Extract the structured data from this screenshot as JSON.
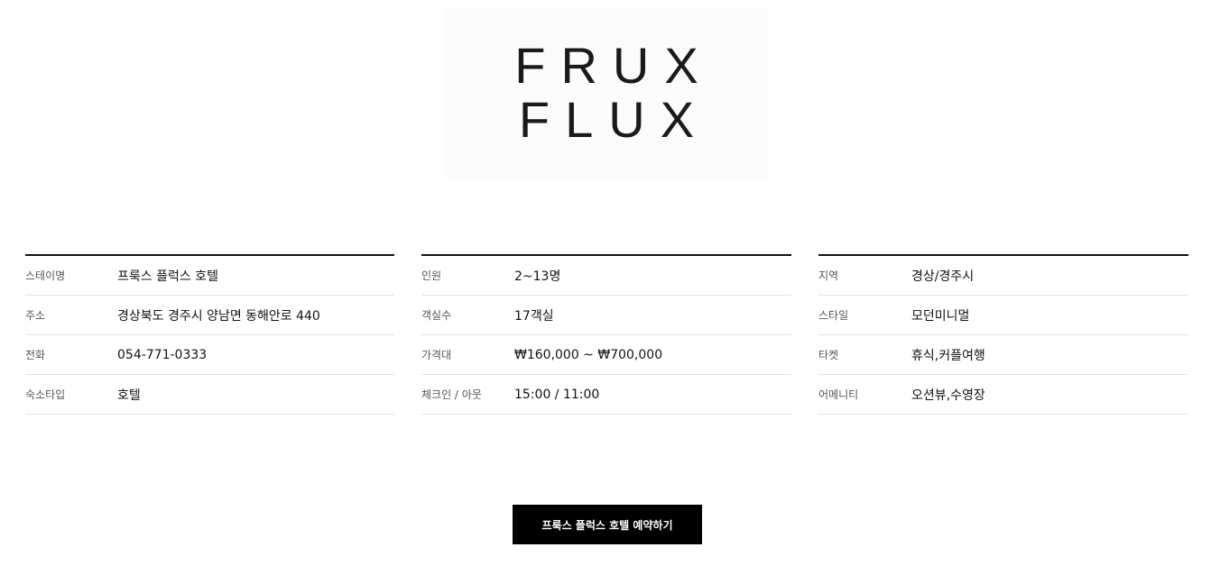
{
  "logo": {
    "line1": "FRUX",
    "line2": "FLUX"
  },
  "info": {
    "col1": [
      {
        "label": "스테이명",
        "value": "프룩스 플럭스 호텔"
      },
      {
        "label": "주소",
        "value": "경상북도 경주시 양남면 동해안로 440"
      },
      {
        "label": "전화",
        "value": "054-771-0333"
      },
      {
        "label": "숙소타입",
        "value": "호텔"
      }
    ],
    "col2": [
      {
        "label": "인원",
        "value": "2~13명"
      },
      {
        "label": "객실수",
        "value": "17객실"
      },
      {
        "label": "가격대",
        "value": "₩160,000 ~ ₩700,000"
      },
      {
        "label": "체크인 / 아웃",
        "value": "15:00 / 11:00"
      }
    ],
    "col3": [
      {
        "label": "지역",
        "value": "경상/경주시"
      },
      {
        "label": "스타일",
        "value": "모던미니멀"
      },
      {
        "label": "타켓",
        "value": "휴식,커플여행"
      },
      {
        "label": "어메니티",
        "value": "오션뷰,수영장"
      }
    ]
  },
  "booking": {
    "button_label": "프룩스 플럭스 호텔 예약하기"
  },
  "colors": {
    "accent": "#000000",
    "divider": "#e2e2e2",
    "label": "#555555"
  }
}
